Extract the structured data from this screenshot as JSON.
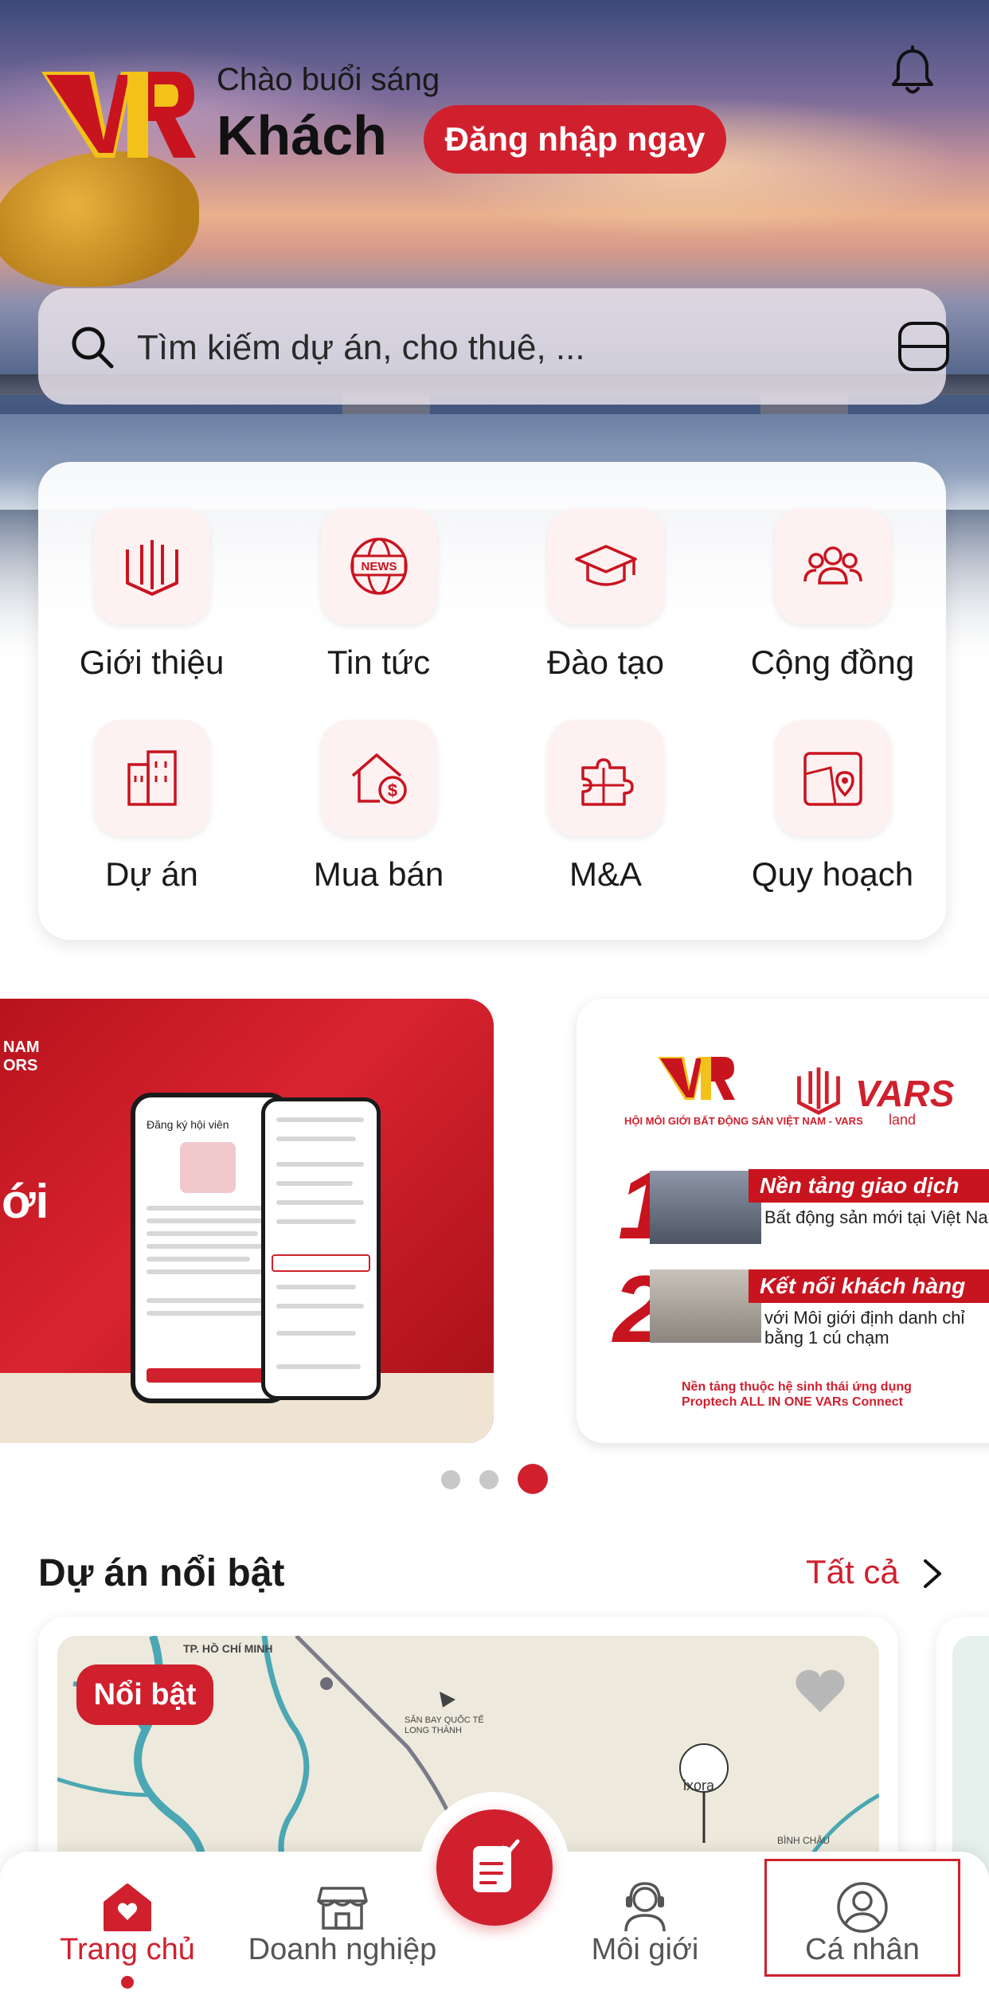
{
  "header": {
    "greeting": "Chào buổi sáng",
    "user_name": "Khách",
    "login_button": "Đăng nhập ngay",
    "logo_icon": "vr-logo",
    "bell_icon": "bell-icon"
  },
  "search": {
    "placeholder": "Tìm kiếm dự án, cho thuê, ...",
    "search_icon": "search-icon",
    "scan_icon": "scan-icon"
  },
  "menu": {
    "items": [
      {
        "label": "Giới thiệu",
        "icon": "vars-logo-icon"
      },
      {
        "label": "Tin tức",
        "icon": "news-globe-icon"
      },
      {
        "label": "Đào tạo",
        "icon": "graduation-cap-icon"
      },
      {
        "label": "Cộng đồng",
        "icon": "community-icon"
      },
      {
        "label": "Dự án",
        "icon": "building-icon"
      },
      {
        "label": "Mua bán",
        "icon": "house-dollar-icon"
      },
      {
        "label": "M&A",
        "icon": "puzzle-icon"
      },
      {
        "label": "Quy hoạch",
        "icon": "map-pin-icon"
      }
    ]
  },
  "banners": {
    "left": {
      "tag_line1": "NAM",
      "tag_line2": "ORS",
      "big_text": "ới",
      "phone_title": "Đăng ký hội viên"
    },
    "right": {
      "association": "HỘI MÔI GIỚI BẤT ĐỘNG SẢN VIỆT NAM - VARS",
      "brand": "VARS",
      "brand_sub": "land",
      "item1_num": "1",
      "item1_title": "Nền tảng giao dịch",
      "item1_text": "Bất động sản mới tại Việt Nam",
      "item2_num": "2",
      "item2_title": "Kết nối khách hàng",
      "item2_text": "với Môi giới định danh chỉ bằng 1 cú chạm",
      "footer_line1": "Nền tảng thuộc hệ sinh thái ứng dụng",
      "footer_line2": "Proptech ALL IN ONE VARs Connect"
    },
    "carousel_count": 3,
    "carousel_active_index": 2
  },
  "featured": {
    "title": "Dự án nổi bật",
    "see_all": "Tất cả",
    "card": {
      "badge": "Nổi bật",
      "map_labels": [
        "TP. HỒ CHÍ MINH",
        "SÂN BAY QUỐC TẾ LONG THÀNH",
        "ixora",
        "BÌNH CHÂU"
      ]
    }
  },
  "tabbar": {
    "items": [
      {
        "label": "Trang chủ",
        "icon": "home-heart-icon",
        "active": true
      },
      {
        "label": "Doanh nghiệp",
        "icon": "store-icon",
        "active": false
      },
      {
        "label": "Môi giới",
        "icon": "agent-headset-icon",
        "active": false
      },
      {
        "label": "Cá nhân",
        "icon": "user-circle-icon",
        "active": false
      }
    ],
    "center_action_icon": "clipboard-check-icon"
  },
  "colors": {
    "brand_red": "#d0202e",
    "text_dark": "#1a1a1a",
    "tab_inactive": "#555555"
  }
}
